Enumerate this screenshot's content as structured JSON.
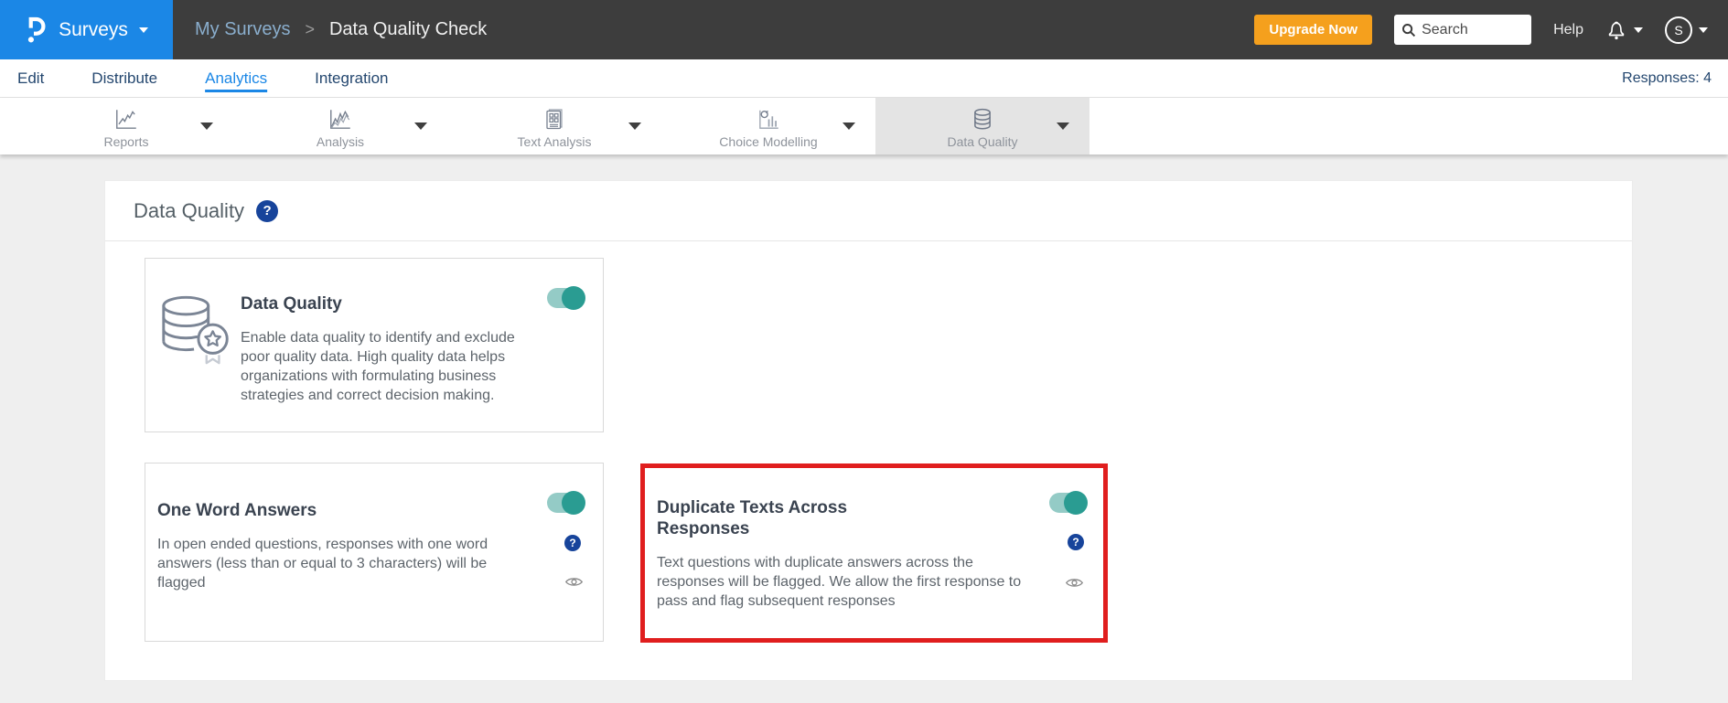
{
  "header": {
    "product": "Surveys",
    "breadcrumb": {
      "parent": "My Surveys",
      "separator": ">",
      "current": "Data Quality Check"
    },
    "upgrade_label": "Upgrade Now",
    "search_placeholder": "Search",
    "help_label": "Help",
    "avatar_initial": "S"
  },
  "nav": {
    "tabs": [
      {
        "label": "Edit",
        "active": false
      },
      {
        "label": "Distribute",
        "active": false
      },
      {
        "label": "Analytics",
        "active": true
      },
      {
        "label": "Integration",
        "active": false
      }
    ],
    "responses_label": "Responses: 4"
  },
  "subnav": {
    "tabs": [
      {
        "label": "Reports",
        "icon": "line-chart-icon",
        "active": false
      },
      {
        "label": "Analysis",
        "icon": "multi-line-chart-icon",
        "active": false
      },
      {
        "label": "Text Analysis",
        "icon": "document-grid-icon",
        "active": false
      },
      {
        "label": "Choice Modelling",
        "icon": "scatter-bar-icon",
        "active": false
      },
      {
        "label": "Data Quality",
        "icon": "database-icon",
        "active": true
      }
    ]
  },
  "main": {
    "title": "Data Quality",
    "help_glyph": "?",
    "feature_card": {
      "title": "Data Quality",
      "description": "Enable data quality to identify and exclude poor quality data. High quality data helps organizations with formulating business strategies and correct decision making.",
      "toggle_on": true,
      "icon": "database-star-icon"
    },
    "rule_cards": [
      {
        "title": "One Word Answers",
        "description": "In open ended questions, responses with one word answers (less than or equal to 3 characters) will be flagged",
        "toggle_on": true,
        "highlighted": false
      },
      {
        "title": "Duplicate Texts Across Responses",
        "description": "Text questions with duplicate answers across the responses will be flagged. We allow the first response to pass and flag subsequent responses",
        "toggle_on": true,
        "highlighted": true
      }
    ]
  },
  "colors": {
    "brand_blue": "#1b87e6",
    "topbar_gray": "#3d3d3d",
    "upgrade_orange": "#f5a01d",
    "nav_navy": "#24476f",
    "toggle_teal": "#2a9c92",
    "toggle_track": "#94cbc6",
    "help_badge_navy": "#17449b",
    "highlight_red": "#e01e1e"
  }
}
